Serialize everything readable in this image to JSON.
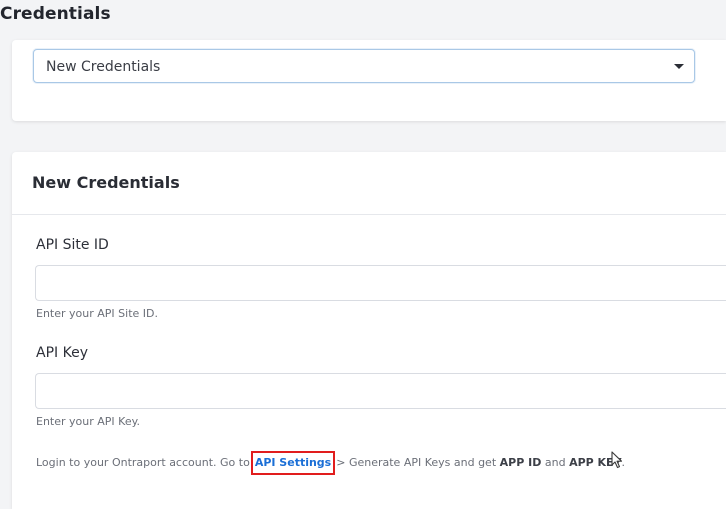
{
  "page": {
    "title": "Credentials"
  },
  "selector": {
    "selected_value": "New Credentials"
  },
  "form": {
    "title": "New Credentials",
    "fields": [
      {
        "label": "API Site ID",
        "value": "",
        "helper": "Enter your API Site ID."
      },
      {
        "label": "API Key",
        "value": "",
        "helper": "Enter your API Key."
      }
    ],
    "instruction": {
      "before_link": "Login to your Ontraport account. Go to",
      "link_text": "API Settings",
      "after_link": "> Generate API Keys and get",
      "bold_1": "APP ID",
      "and_text": "and",
      "bold_2": "APP KEY",
      "end": "."
    }
  },
  "colors": {
    "link": "#1b6fd6",
    "highlight_box": "#e11d1d",
    "select_border": "#a9c8e6"
  },
  "icons": {
    "dropdown": "caret-down-icon",
    "pointer": "mouse-cursor-icon"
  }
}
